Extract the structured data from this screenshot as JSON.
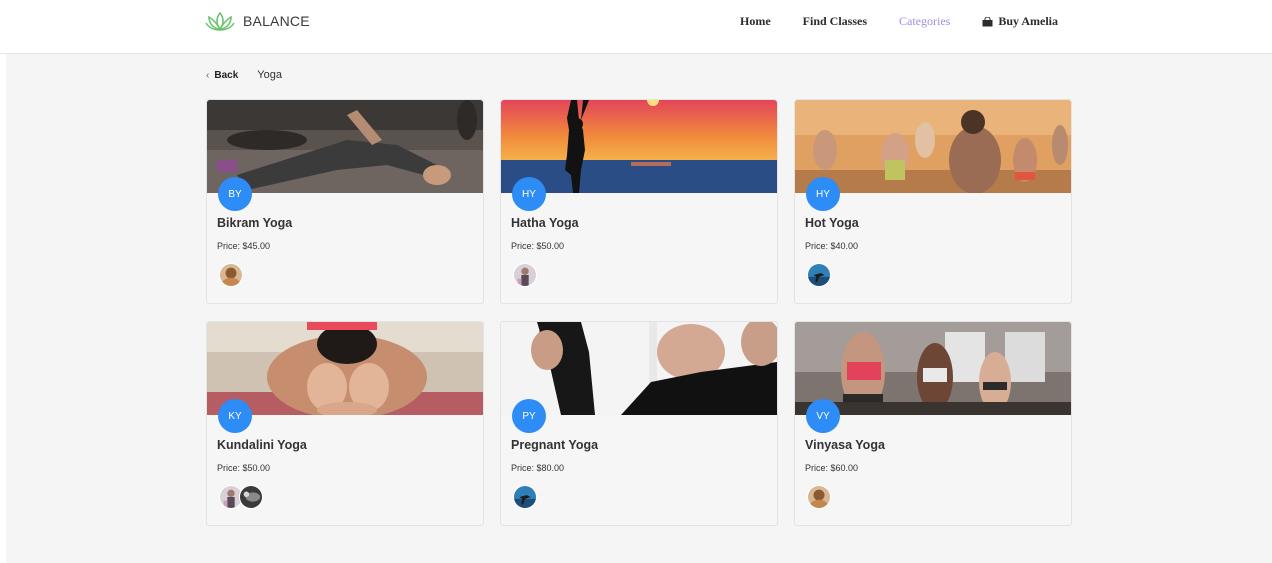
{
  "header": {
    "logo_text": "BALANCE",
    "nav": {
      "home": "Home",
      "find_classes": "Find Classes",
      "categories": "Categories",
      "buy": "Buy Amelia"
    },
    "active_color": "#9b8ee6"
  },
  "breadcrumb": {
    "back": "Back",
    "title": "Yoga"
  },
  "accent": "#2d8cf5",
  "cards": [
    {
      "initials": "BY",
      "name": "Bikram Yoga",
      "price": "Price: $45.00"
    },
    {
      "initials": "HY",
      "name": "Hatha Yoga",
      "price": "Price: $50.00"
    },
    {
      "initials": "HY",
      "name": "Hot Yoga",
      "price": "Price: $40.00"
    },
    {
      "initials": "KY",
      "name": "Kundalini Yoga",
      "price": "Price: $50.00"
    },
    {
      "initials": "PY",
      "name": "Pregnant Yoga",
      "price": "Price: $80.00"
    },
    {
      "initials": "VY",
      "name": "Vinyasa Yoga",
      "price": "Price: $60.00"
    }
  ]
}
